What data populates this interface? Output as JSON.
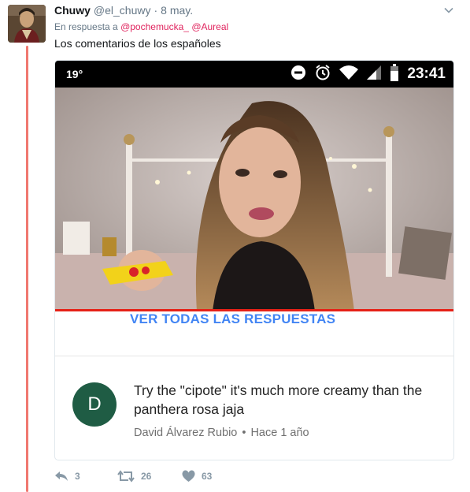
{
  "tweet": {
    "author_name": "Chuwy",
    "author_handle": "@el_chuwy",
    "separator": "·",
    "date": "8 may.",
    "reply_prefix": "En respuesta a",
    "reply_mention_1": "@pochemucka_",
    "reply_mention_2": "@Aureal",
    "text": "Los comentarios de los españoles"
  },
  "screenshot": {
    "status_left": "19°",
    "status_time": "23:41",
    "view_replies_label": "VER TODAS LAS RESPUESTAS",
    "progress_percent": 100,
    "comment": {
      "avatar_letter": "D",
      "text": "Try the \"cipote\" it's much more creamy than the panthera rosa jaja",
      "author": "David Álvarez Rubio",
      "separator": "•",
      "time": "Hace 1 año"
    }
  },
  "actions": {
    "replies": "3",
    "retweets": "26",
    "likes": "63"
  },
  "colors": {
    "thread_line": "#f07870",
    "mention": "#e0245e",
    "link_blue": "#4285f4",
    "comment_avatar_bg": "#1f5c44",
    "progress_red": "#e62117"
  }
}
